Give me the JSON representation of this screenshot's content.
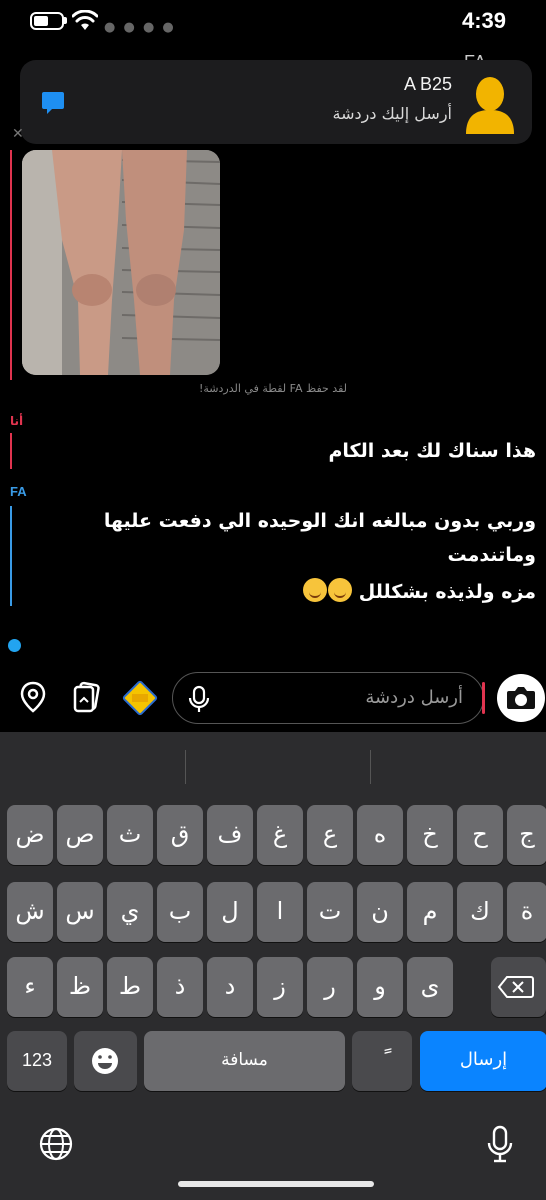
{
  "status_bar": {
    "time": "4:39"
  },
  "header": {
    "initials": "FA"
  },
  "notification": {
    "title": "A B25",
    "body": "أرسل إليك دردشة",
    "icon": "chat-bubble-icon",
    "avatar": "default-avatar-icon",
    "accent": "#0a84ff"
  },
  "chat": {
    "saved_note": "لقد حفظ FA لقطة في الدردشة!",
    "me_label": "أنا",
    "me_message": "هذا سناك لك بعد الكام",
    "fa_label": "FA",
    "fa_line1": "وربي بدون مبالغه انك الوحيده الي دفعت عليها",
    "fa_line2": "وماتندمت",
    "fa_line3": "مزه ولذيذه بشكللل",
    "colors": {
      "me": "#e0344f",
      "fa": "#3a9be6"
    }
  },
  "input": {
    "placeholder": "أرسل دردشة",
    "icons": [
      "location-pin-icon",
      "memories-icon",
      "bitmoji-icon",
      "microphone-icon",
      "camera-icon"
    ]
  },
  "keyboard": {
    "row1": [
      "ض",
      "ص",
      "ث",
      "ق",
      "ف",
      "غ",
      "ع",
      "ه",
      "خ",
      "ح",
      "ج"
    ],
    "row2": [
      "ش",
      "س",
      "ي",
      "ب",
      "ل",
      "ا",
      "ت",
      "ن",
      "م",
      "ك",
      "ة"
    ],
    "row3": [
      "ء",
      "ظ",
      "ط",
      "ذ",
      "د",
      "ز",
      "ر",
      "و",
      "ى"
    ],
    "numbers": "123",
    "space": "مسافة",
    "diacritic": "ً",
    "send": "إرسال"
  }
}
